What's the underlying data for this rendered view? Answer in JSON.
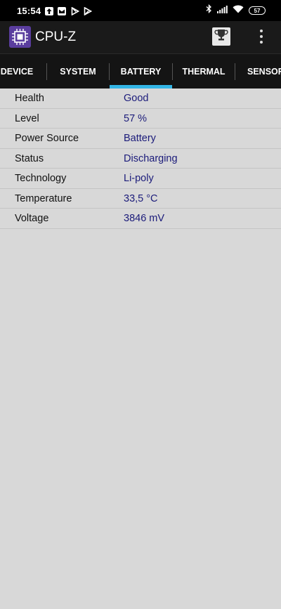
{
  "status_bar": {
    "time": "15:54",
    "battery_level": "57",
    "icons": [
      "upload-icon",
      "mail-icon",
      "play-store-icon",
      "play-store-icon",
      "bluetooth-icon",
      "signal-icon",
      "wifi-icon",
      "battery-icon"
    ]
  },
  "app_bar": {
    "title": "CPU-Z",
    "logo_icon": "cpu-chip-icon",
    "actions": [
      "trophy-icon",
      "overflow-menu-icon"
    ]
  },
  "tabs": {
    "items": [
      {
        "label": "DEVICE"
      },
      {
        "label": "SYSTEM"
      },
      {
        "label": "BATTERY"
      },
      {
        "label": "THERMAL"
      },
      {
        "label": "SENSORS"
      }
    ],
    "selected": "BATTERY",
    "indicator_color": "#33b5e5"
  },
  "battery": {
    "rows": [
      {
        "label": "Health",
        "value": "Good"
      },
      {
        "label": "Level",
        "value": "57 %"
      },
      {
        "label": "Power Source",
        "value": "Battery"
      },
      {
        "label": "Status",
        "value": "Discharging"
      },
      {
        "label": "Technology",
        "value": "Li-poly"
      },
      {
        "label": "Temperature",
        "value": "33,5 °C"
      },
      {
        "label": "Voltage",
        "value": "3846 mV"
      }
    ]
  },
  "colors": {
    "value_text": "#1b1b7a",
    "background": "#d8d8d8",
    "app_bar": "#1a1a1a",
    "logo": "#5a3d9e"
  }
}
